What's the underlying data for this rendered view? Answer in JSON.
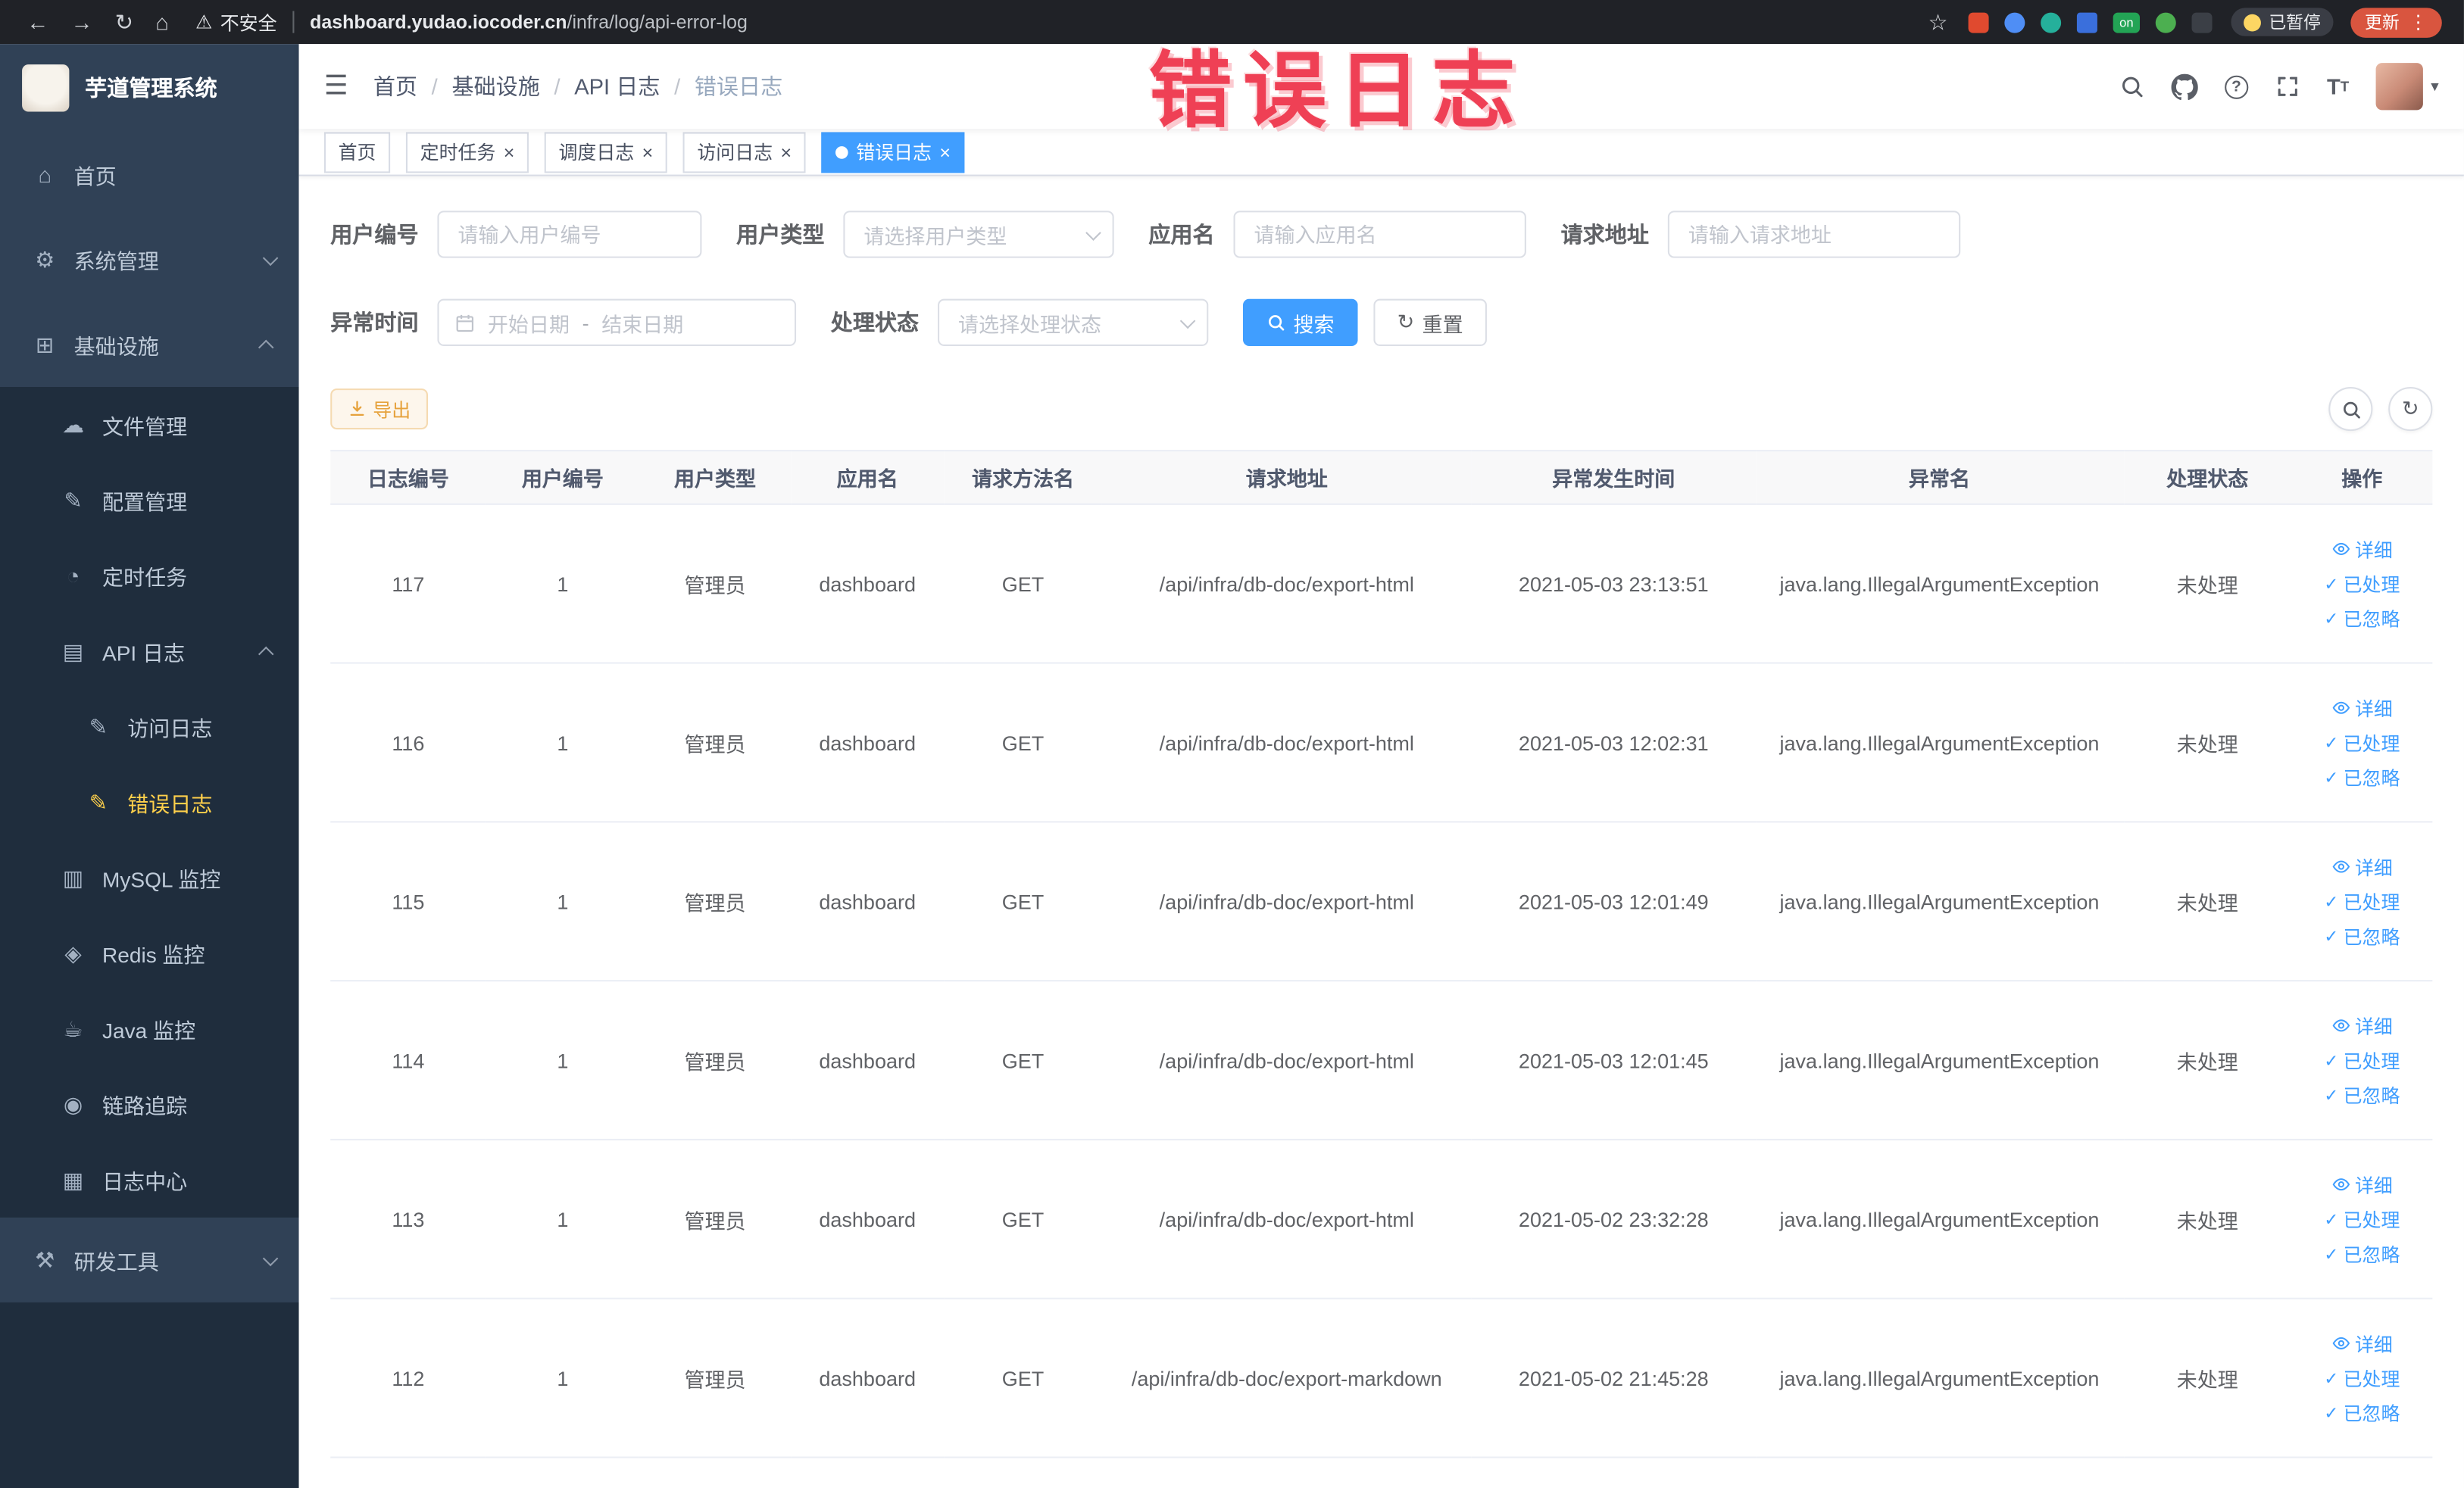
{
  "browser": {
    "security_label": "不安全",
    "url_domain": "dashboard.yudao.iocoder.cn",
    "url_path": "/infra/log/api-error-log",
    "ext_on_badge": "on",
    "paused_badge": "已暂停",
    "update_button": "更新"
  },
  "icons": {
    "back": "←",
    "forward": "→",
    "reload": "↻",
    "browser_home": "⌂",
    "warning": "⚠",
    "star": "☆",
    "menu_dots": "⋮",
    "hamburger": "☰",
    "question": "?",
    "font_large": "T",
    "font_small": "T",
    "caret": "▾",
    "close": "×",
    "check": "✓",
    "refresh": "↻",
    "home": "⌂",
    "system": "⚙",
    "infra": "⊞",
    "file": "☁",
    "config": "✎",
    "timer": "◔",
    "api_log": "▤",
    "access_log": "✎",
    "error_log": "✎",
    "mysql": "▥",
    "redis": "◈",
    "java": "☕",
    "trace": "◉",
    "log_center": "▦",
    "tools": "⚒"
  },
  "sidebar": {
    "logo_title": "芋道管理系统",
    "menu": [
      {
        "label": "首页"
      },
      {
        "label": "系统管理"
      },
      {
        "label": "基础设施"
      },
      {
        "label": "文件管理"
      },
      {
        "label": "配置管理"
      },
      {
        "label": "定时任务"
      },
      {
        "label": "API 日志"
      },
      {
        "label": "访问日志"
      },
      {
        "label": "错误日志"
      },
      {
        "label": "MySQL 监控"
      },
      {
        "label": "Redis 监控"
      },
      {
        "label": "Java 监控"
      },
      {
        "label": "链路追踪"
      },
      {
        "label": "日志中心"
      },
      {
        "label": "研发工具"
      }
    ]
  },
  "breadcrumb": [
    "首页",
    "基础设施",
    "API 日志",
    "错误日志"
  ],
  "annotation_text": "错误日志",
  "tabs": [
    {
      "label": "首页"
    },
    {
      "label": "定时任务"
    },
    {
      "label": "调度日志"
    },
    {
      "label": "访问日志"
    },
    {
      "label": "错误日志"
    }
  ],
  "filters": {
    "user_id_label": "用户编号",
    "user_id_placeholder": "请输入用户编号",
    "user_type_label": "用户类型",
    "user_type_placeholder": "请选择用户类型",
    "app_name_label": "应用名",
    "app_name_placeholder": "请输入应用名",
    "request_url_label": "请求地址",
    "request_url_placeholder": "请输入请求地址",
    "exception_time_label": "异常时间",
    "date_start_placeholder": "开始日期",
    "date_separator": "-",
    "date_end_placeholder": "结束日期",
    "process_status_label": "处理状态",
    "process_status_placeholder": "请选择处理状态",
    "search_label": "搜索",
    "reset_label": "重置"
  },
  "toolbar": {
    "export_label": "导出"
  },
  "table": {
    "columns": [
      "日志编号",
      "用户编号",
      "用户类型",
      "应用名",
      "请求方法名",
      "请求地址",
      "异常发生时间",
      "异常名",
      "处理状态",
      "操作"
    ],
    "action_labels": {
      "detail": "详细",
      "processed": "已处理",
      "ignored": "已忽略"
    },
    "rows": [
      {
        "id": "117",
        "user_id": "1",
        "user_type": "管理员",
        "app": "dashboard",
        "method": "GET",
        "url": "/api/infra/db-doc/export-html",
        "time": "2021-05-03 23:13:51",
        "exception": "java.lang.IllegalArgumentException",
        "status": "未处理"
      },
      {
        "id": "116",
        "user_id": "1",
        "user_type": "管理员",
        "app": "dashboard",
        "method": "GET",
        "url": "/api/infra/db-doc/export-html",
        "time": "2021-05-03 12:02:31",
        "exception": "java.lang.IllegalArgumentException",
        "status": "未处理"
      },
      {
        "id": "115",
        "user_id": "1",
        "user_type": "管理员",
        "app": "dashboard",
        "method": "GET",
        "url": "/api/infra/db-doc/export-html",
        "time": "2021-05-03 12:01:49",
        "exception": "java.lang.IllegalArgumentException",
        "status": "未处理"
      },
      {
        "id": "114",
        "user_id": "1",
        "user_type": "管理员",
        "app": "dashboard",
        "method": "GET",
        "url": "/api/infra/db-doc/export-html",
        "time": "2021-05-03 12:01:45",
        "exception": "java.lang.IllegalArgumentException",
        "status": "未处理"
      },
      {
        "id": "113",
        "user_id": "1",
        "user_type": "管理员",
        "app": "dashboard",
        "method": "GET",
        "url": "/api/infra/db-doc/export-html",
        "time": "2021-05-02 23:32:28",
        "exception": "java.lang.IllegalArgumentException",
        "status": "未处理"
      },
      {
        "id": "112",
        "user_id": "1",
        "user_type": "管理员",
        "app": "dashboard",
        "method": "GET",
        "url": "/api/infra/db-doc/export-markdown",
        "time": "2021-05-02 21:45:28",
        "exception": "java.lang.IllegalArgumentException",
        "status": "未处理"
      }
    ]
  }
}
